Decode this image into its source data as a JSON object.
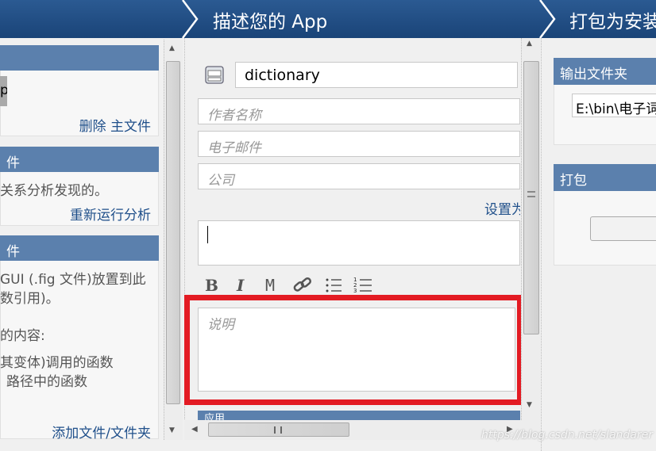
{
  "header": {
    "steps": [
      "描述您的 App",
      "打包为安装"
    ]
  },
  "left": {
    "section1": {
      "value_fragment": "p",
      "link": "删除 主文件"
    },
    "section2": {
      "title": "件",
      "text": "关系分析发现的。",
      "link": "重新运行分析"
    },
    "section3": {
      "title": "件",
      "lines": [
        "GUI (.fig 文件)放置到此",
        "数引用)。",
        "的内容:",
        "其变体)调用的函数",
        "路径中的函数"
      ],
      "link": "添加文件/文件夹"
    }
  },
  "middle": {
    "app_name": "dictionary",
    "author_placeholder": "作者名称",
    "email_placeholder": "电子邮件",
    "company_placeholder": "公司",
    "set_link": "设置为",
    "toolbar": [
      "B",
      "I",
      "M"
    ],
    "description_placeholder": "说明",
    "next_section": "应用"
  },
  "right": {
    "output_title": "输出文件夹",
    "output_path": "E:\\bin\\电子词",
    "package_title": "打包"
  },
  "highlight_color": "#e31b23",
  "watermark": "https://blog.csdn.net/slandarer"
}
